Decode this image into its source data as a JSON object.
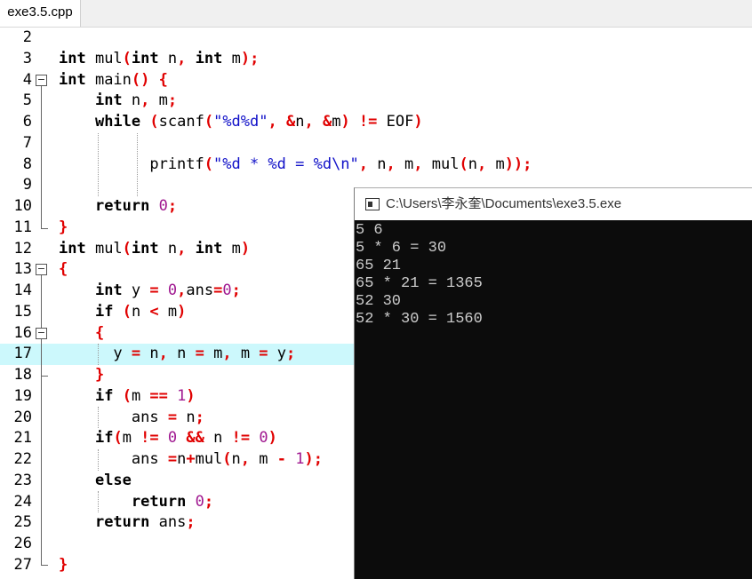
{
  "tab": {
    "filename": "exe3.5.cpp"
  },
  "editor": {
    "lines": [
      {
        "num": "2"
      },
      {
        "num": "3"
      },
      {
        "num": "4"
      },
      {
        "num": "5"
      },
      {
        "num": "6"
      },
      {
        "num": "7"
      },
      {
        "num": "8"
      },
      {
        "num": "9"
      },
      {
        "num": "10"
      },
      {
        "num": "11"
      },
      {
        "num": "12"
      },
      {
        "num": "13"
      },
      {
        "num": "14"
      },
      {
        "num": "15"
      },
      {
        "num": "16"
      },
      {
        "num": "17"
      },
      {
        "num": "18"
      },
      {
        "num": "19"
      },
      {
        "num": "20"
      },
      {
        "num": "21"
      },
      {
        "num": "22"
      },
      {
        "num": "23"
      },
      {
        "num": "24"
      },
      {
        "num": "25"
      },
      {
        "num": "26"
      },
      {
        "num": "27"
      }
    ],
    "highlight_color": "#ccf8fc"
  },
  "console": {
    "title": "C:\\Users\\李永奎\\Documents\\exe3.5.exe",
    "output": [
      "5 6",
      "5 * 6 = 30",
      "65 21",
      "65 * 21 = 1365",
      "52 30",
      "52 * 30 = 1560"
    ]
  }
}
